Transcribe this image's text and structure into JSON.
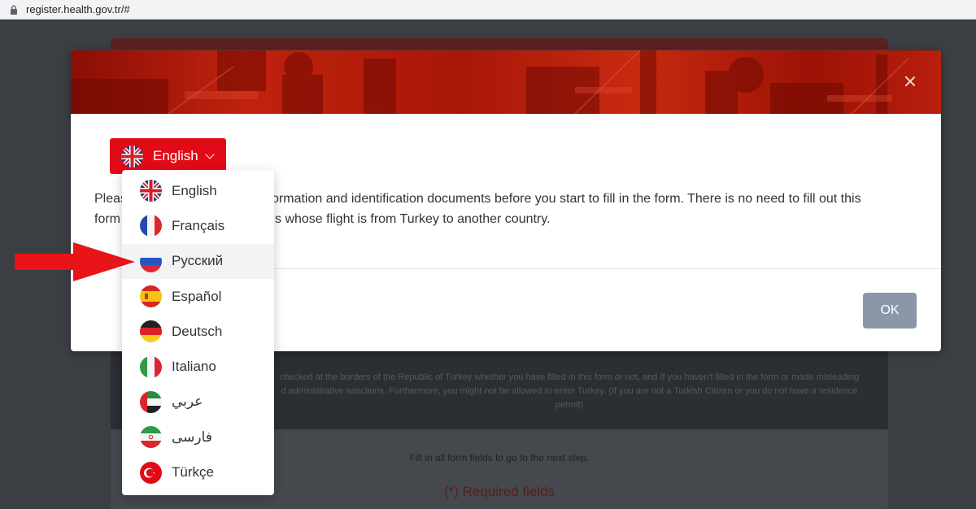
{
  "browser": {
    "url": "register.health.gov.tr/#"
  },
  "background_page": {
    "warning_text_line1": "checked at the borders of the Republic of Turkey whether you have filled in this form or not, and If you haven't filled in the form or made misleading",
    "warning_text_line2": "d administrative sanctions. Furthermore, you might not be allowed to enter Turkey. (If you are not a Turkish Citizen or you do not have a residence",
    "warning_text_line3": "permit)",
    "fill_in_text": "Fill in all form fields to go to the next step.",
    "required_text": "(*) Required fields"
  },
  "modal": {
    "language_button_label": "English",
    "intro_line1_start": "Pleas",
    "intro_line1_end": "ormation and identification documents before you start to fill in the form. There is no need to fill out this",
    "intro_line2_start": "form",
    "intro_line2_end": "s whose flight is from Turkey to another country.",
    "ok_label": "OK"
  },
  "language_menu": {
    "items": [
      {
        "label": "English",
        "flag": "uk-flag-icon"
      },
      {
        "label": "Français",
        "flag": "france-flag-icon"
      },
      {
        "label": "Русский",
        "flag": "russia-flag-icon"
      },
      {
        "label": "Español",
        "flag": "spain-flag-icon"
      },
      {
        "label": "Deutsch",
        "flag": "germany-flag-icon"
      },
      {
        "label": "Italiano",
        "flag": "italy-flag-icon"
      },
      {
        "label": "عربي",
        "flag": "uae-flag-icon"
      },
      {
        "label": "فارسی",
        "flag": "iran-flag-icon"
      },
      {
        "label": "Türkçe",
        "flag": "turkey-flag-icon"
      }
    ],
    "highlighted": "Русский"
  },
  "colors": {
    "accent": "#e30a17",
    "ok_button": "#8a97a6",
    "annotation_arrow": "#e8141a"
  }
}
